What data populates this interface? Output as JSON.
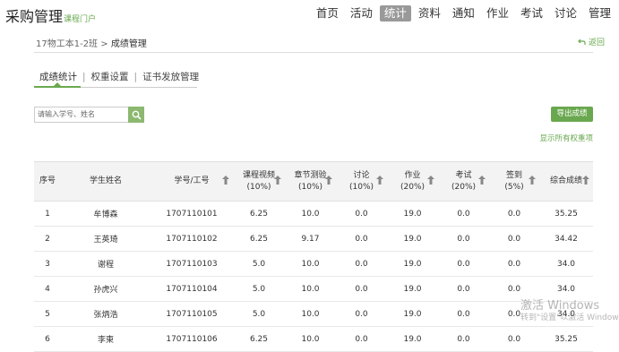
{
  "header": {
    "brand": "采购管理",
    "brand_sub": "课程门户",
    "nav": [
      "首页",
      "活动",
      "统计",
      "资料",
      "通知",
      "作业",
      "考试",
      "讨论",
      "管理"
    ],
    "active_nav": "统计"
  },
  "breadcrumb": {
    "course": "17物工本1-2班",
    "separator": ">",
    "current": "成绩管理",
    "back": "返回"
  },
  "tabs": [
    "成绩统计",
    "权重设置",
    "证书发放管理"
  ],
  "search": {
    "placeholder": "请输入学号、姓名"
  },
  "actions": {
    "export": "导出成绩",
    "show_all": "显示所有权重项"
  },
  "table": {
    "headers": [
      {
        "line1": "序号",
        "line2": ""
      },
      {
        "line1": "学生姓名",
        "line2": ""
      },
      {
        "line1": "学号/工号",
        "line2": ""
      },
      {
        "line1": "课程视频",
        "line2": "(10%)"
      },
      {
        "line1": "章节测验",
        "line2": "(10%)"
      },
      {
        "line1": "讨论",
        "line2": "(10%)"
      },
      {
        "line1": "作业",
        "line2": "(20%)"
      },
      {
        "line1": "考试",
        "line2": "(20%)"
      },
      {
        "line1": "签到",
        "line2": "(5%)"
      },
      {
        "line1": "综合成绩",
        "line2": ""
      }
    ],
    "rows": [
      [
        "1",
        "牟博森",
        "1707110101",
        "6.25",
        "10.0",
        "0.0",
        "19.0",
        "0.0",
        "0.0",
        "35.25"
      ],
      [
        "2",
        "王英琦",
        "1707110102",
        "6.25",
        "9.17",
        "0.0",
        "19.0",
        "0.0",
        "0.0",
        "34.42"
      ],
      [
        "3",
        "谢程",
        "1707110103",
        "5.0",
        "10.0",
        "0.0",
        "19.0",
        "0.0",
        "0.0",
        "34.0"
      ],
      [
        "4",
        "孙虎兴",
        "1707110104",
        "5.0",
        "10.0",
        "0.0",
        "19.0",
        "0.0",
        "0.0",
        "34.0"
      ],
      [
        "5",
        "张炳浩",
        "1707110105",
        "5.0",
        "10.0",
        "0.0",
        "19.0",
        "0.0",
        "0.0",
        "34.0"
      ],
      [
        "6",
        "李東",
        "1707110106",
        "6.25",
        "10.0",
        "0.0",
        "19.0",
        "0.0",
        "0.0",
        "35.25"
      ]
    ]
  },
  "watermark": {
    "line1": "激活 Windows",
    "line2": "转到\"设置\"以激活 Windows"
  },
  "colors": {
    "accent": "#6aa84f",
    "nav_active_bg": "#999999",
    "header_row_bg": "#f3f3f3"
  }
}
